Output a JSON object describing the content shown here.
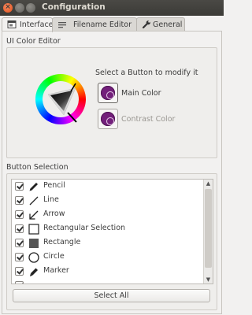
{
  "window": {
    "title": "Configuration"
  },
  "tabs": [
    {
      "label": "Interface",
      "icon": "interface-icon",
      "active": true
    },
    {
      "label": "Filename Editor",
      "icon": "filename-editor-icon",
      "active": false
    },
    {
      "label": "General",
      "icon": "wrench-icon",
      "active": false
    }
  ],
  "color_editor": {
    "title": "UI Color Editor",
    "prompt": "Select a Button to modify it",
    "main_label": "Main Color",
    "contrast_label": "Contrast Color",
    "selected_color": "#73207b"
  },
  "button_selection": {
    "title": "Button Selection",
    "items": [
      {
        "label": "Pencil",
        "icon": "pencil-icon",
        "checked": true
      },
      {
        "label": "Line",
        "icon": "line-icon",
        "checked": true
      },
      {
        "label": "Arrow",
        "icon": "arrow-icon",
        "checked": true
      },
      {
        "label": "Rectangular Selection",
        "icon": "rectangular-selection-icon",
        "checked": true
      },
      {
        "label": "Rectangle",
        "icon": "rectangle-icon",
        "checked": true
      },
      {
        "label": "Circle",
        "icon": "circle-icon",
        "checked": true
      },
      {
        "label": "Marker",
        "icon": "marker-icon",
        "checked": true
      }
    ],
    "select_all_label": "Select All"
  }
}
